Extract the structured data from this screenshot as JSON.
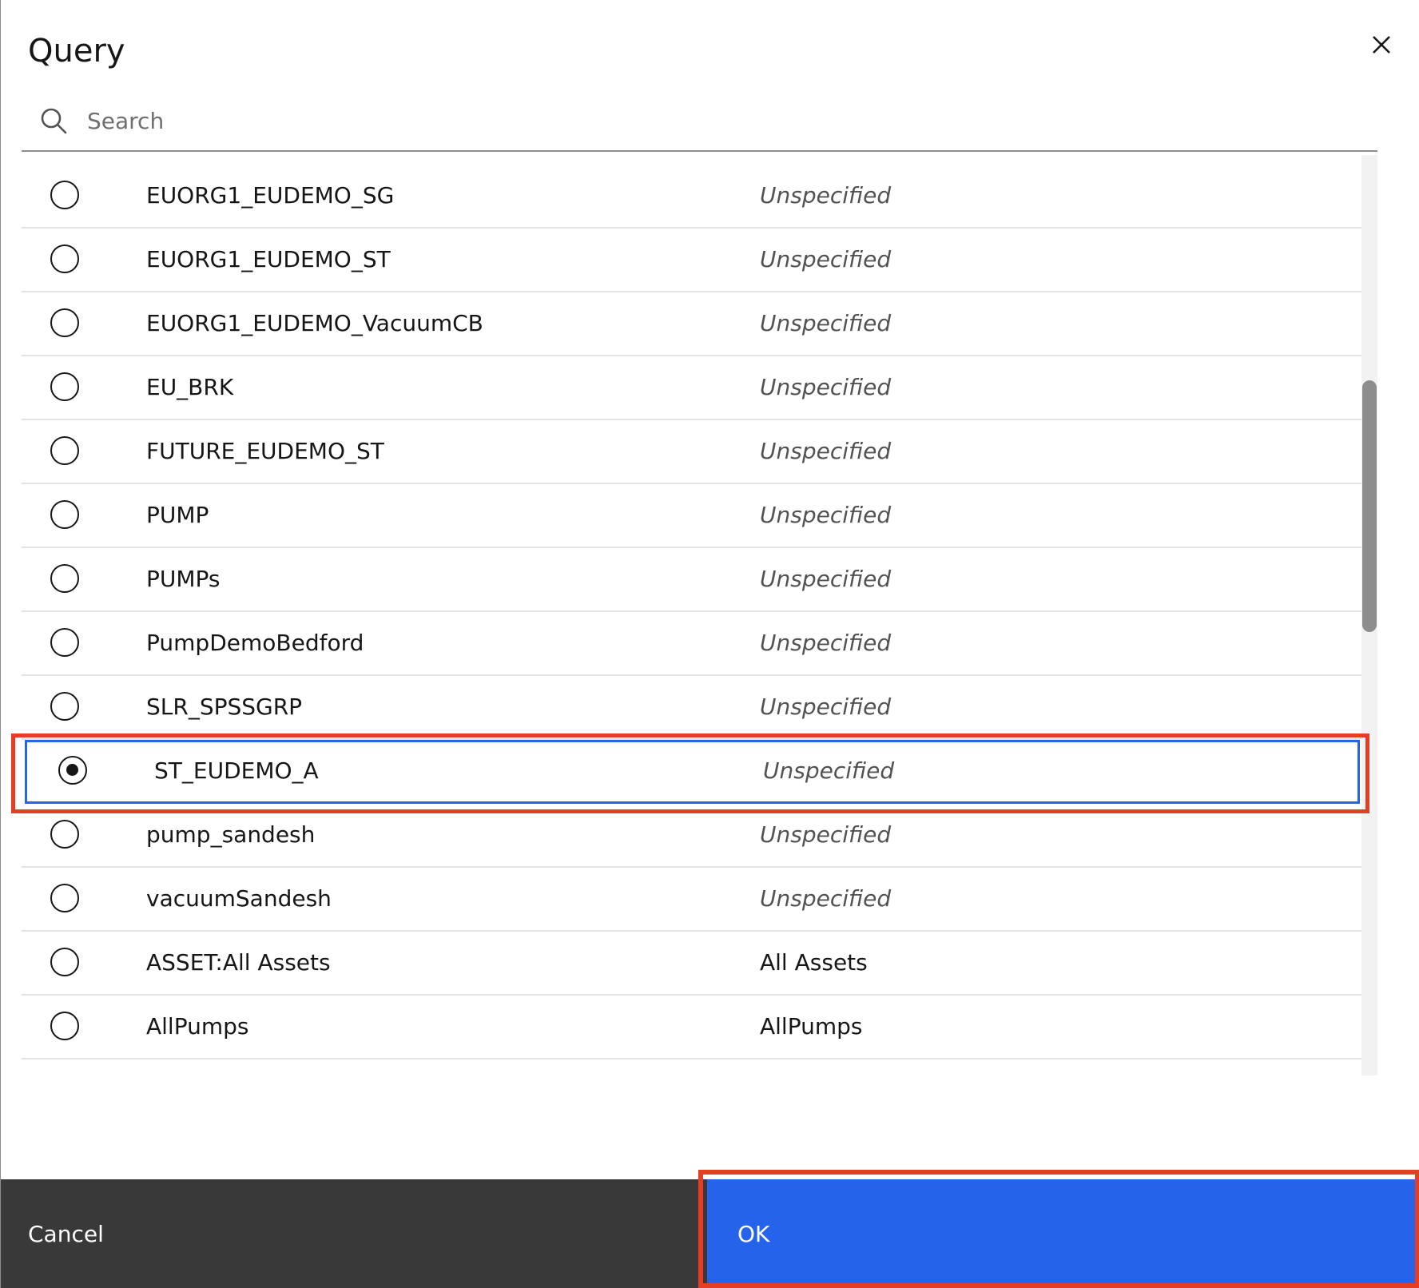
{
  "dialog": {
    "title": "Query",
    "close_icon": "close-icon"
  },
  "search": {
    "placeholder": "Search",
    "value": "",
    "icon": "search-icon"
  },
  "list": {
    "items": [
      {
        "name": "EUORG1_EUDEMO_SG",
        "description": "Unspecified",
        "selected": false
      },
      {
        "name": "EUORG1_EUDEMO_ST",
        "description": "Unspecified",
        "selected": false
      },
      {
        "name": "EUORG1_EUDEMO_VacuumCB",
        "description": "Unspecified",
        "selected": false
      },
      {
        "name": "EU_BRK",
        "description": "Unspecified",
        "selected": false
      },
      {
        "name": "FUTURE_EUDEMO_ST",
        "description": "Unspecified",
        "selected": false
      },
      {
        "name": "PUMP",
        "description": "Unspecified",
        "selected": false
      },
      {
        "name": "PUMPs",
        "description": "Unspecified",
        "selected": false
      },
      {
        "name": "PumpDemoBedford",
        "description": "Unspecified",
        "selected": false
      },
      {
        "name": "SLR_SPSSGRP",
        "description": "Unspecified",
        "selected": false
      },
      {
        "name": "ST_EUDEMO_A",
        "description": "Unspecified",
        "selected": true
      },
      {
        "name": "pump_sandesh",
        "description": "Unspecified",
        "selected": false
      },
      {
        "name": "vacuumSandesh",
        "description": "Unspecified",
        "selected": false
      },
      {
        "name": "ASSET:All Assets",
        "description": "All Assets",
        "selected": false
      },
      {
        "name": "AllPumps",
        "description": "AllPumps",
        "selected": false
      }
    ]
  },
  "footer": {
    "cancel_label": "Cancel",
    "ok_label": "OK"
  },
  "colors": {
    "primary": "#2563eb",
    "footer_dark": "#393939",
    "highlight": "#e53e26"
  }
}
